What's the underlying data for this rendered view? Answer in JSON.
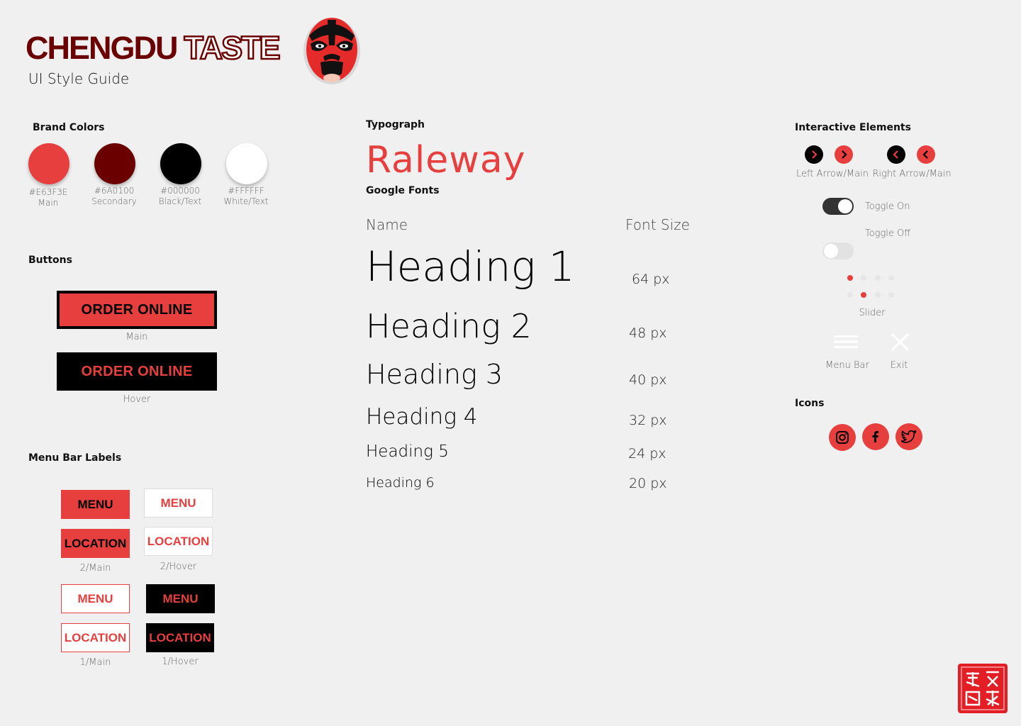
{
  "header": {
    "brand_part1": "CHENGDU",
    "brand_part2": "TASTE",
    "subtitle": "UI Style Guide"
  },
  "colors": {
    "title": "Brand Colors",
    "swatches": [
      {
        "hex": "#E63F3E",
        "code": "#E63F3E",
        "name": "Main"
      },
      {
        "hex": "#6A0100",
        "code": "#6A0100",
        "name": "Secondary"
      },
      {
        "hex": "#000000",
        "code": "#000000",
        "name": "Black/Text"
      },
      {
        "hex": "#FFFFFF",
        "code": "#FFFFFF",
        "name": "White/Text"
      }
    ]
  },
  "buttons": {
    "title": "Buttons",
    "main_label": "ORDER ONLINE",
    "main_caption": "Main",
    "hover_label": "ORDER ONLINE",
    "hover_caption": "Hover"
  },
  "menu_labels": {
    "title": "Menu Bar Labels",
    "menu": "MENU",
    "location": "LOCATION",
    "captions": [
      "2/Main",
      "2/Hover",
      "1/Main",
      "1/Hover"
    ]
  },
  "typography": {
    "title": "Typograph",
    "font_name": "Raleway",
    "source": "Google Fonts",
    "col_name": "Name",
    "col_size": "Font Size",
    "rows": [
      {
        "name": "Heading 1",
        "size": "64 px"
      },
      {
        "name": "Heading 2",
        "size": "48 px"
      },
      {
        "name": "Heading 3",
        "size": "40 px"
      },
      {
        "name": "Heading 4",
        "size": "32 px"
      },
      {
        "name": "Heading 5",
        "size": "24 px"
      },
      {
        "name": "Heading 6",
        "size": "20 px"
      }
    ]
  },
  "interactive": {
    "title": "Interactive Elements",
    "left_arrow_caption": "Left Arrow/Main",
    "right_arrow_caption": "Right Arrow/Main",
    "toggle_on": "Toggle On",
    "toggle_off": "Toggle Off",
    "slider_caption": "Slider",
    "slider_states": [
      1,
      2
    ],
    "menu_bar_caption": "Menu Bar",
    "exit_caption": "Exit"
  },
  "icons": {
    "title": "Icons",
    "items": [
      "instagram-icon",
      "facebook-icon",
      "twitter-icon"
    ]
  }
}
